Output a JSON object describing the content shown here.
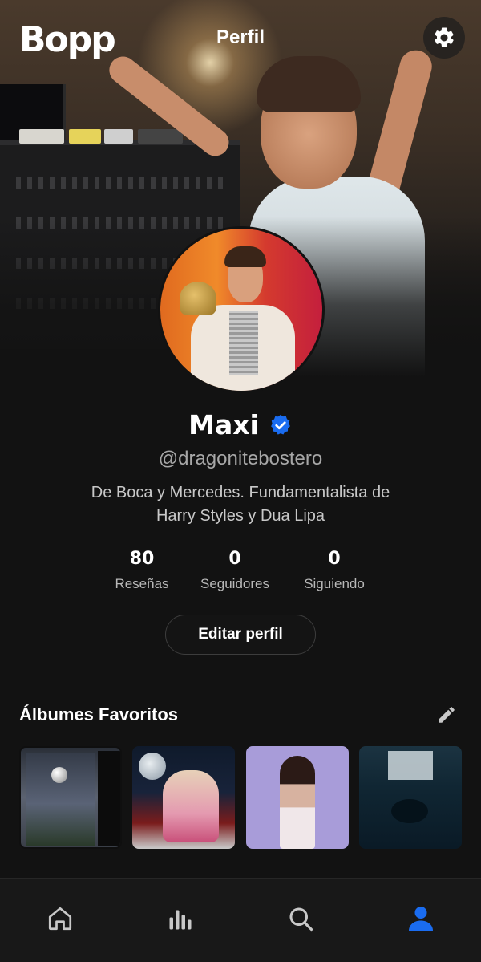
{
  "app": {
    "logo": "Bopp",
    "page_title": "Perfil"
  },
  "profile": {
    "name": "Maxi",
    "verified": true,
    "handle": "@dragonitebostero",
    "bio_line1": "De Boca y Mercedes. Fundamentalista de",
    "bio_line2": "Harry Styles y Dua Lipa"
  },
  "stats": [
    {
      "value": "80",
      "label": "Reseñas"
    },
    {
      "value": "0",
      "label": "Seguidores"
    },
    {
      "value": "0",
      "label": "Siguiendo"
    }
  ],
  "edit_button": {
    "label": "Editar perfil"
  },
  "favorites": {
    "title": "Álbumes Favoritos",
    "albums": [
      {
        "icon": "album-cover-1"
      },
      {
        "icon": "album-cover-2"
      },
      {
        "icon": "album-cover-3"
      },
      {
        "icon": "album-cover-4"
      }
    ]
  },
  "nav": [
    {
      "icon": "home-icon"
    },
    {
      "icon": "stats-icon"
    },
    {
      "icon": "search-icon"
    },
    {
      "icon": "profile-icon",
      "active": true
    }
  ],
  "colors": {
    "background": "#121212",
    "accent": "#1a6cf0",
    "verified": "#1a6cf0",
    "muted_text": "#a7a7a7",
    "nav_icon": "#c8c8c8"
  }
}
